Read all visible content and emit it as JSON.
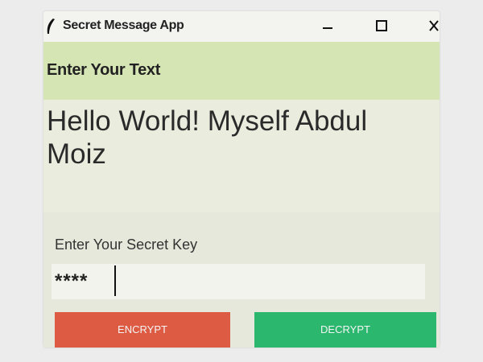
{
  "window": {
    "title": "Secret Message App",
    "icon": "feather-icon",
    "controls": [
      "minimize-icon",
      "maximize-icon",
      "close-icon"
    ]
  },
  "text_section": {
    "label": "Enter Your Text",
    "message": "Hello World! Myself Abdul Moiz"
  },
  "key_section": {
    "label": "Enter Your Secret Key",
    "value": "****"
  },
  "buttons": {
    "encrypt": "ENCRYPT",
    "decrypt": "DECRYPT"
  },
  "colors": {
    "label_bar": "#d5e5b4",
    "encrypt": "#de5b43",
    "decrypt": "#2bb86e"
  }
}
